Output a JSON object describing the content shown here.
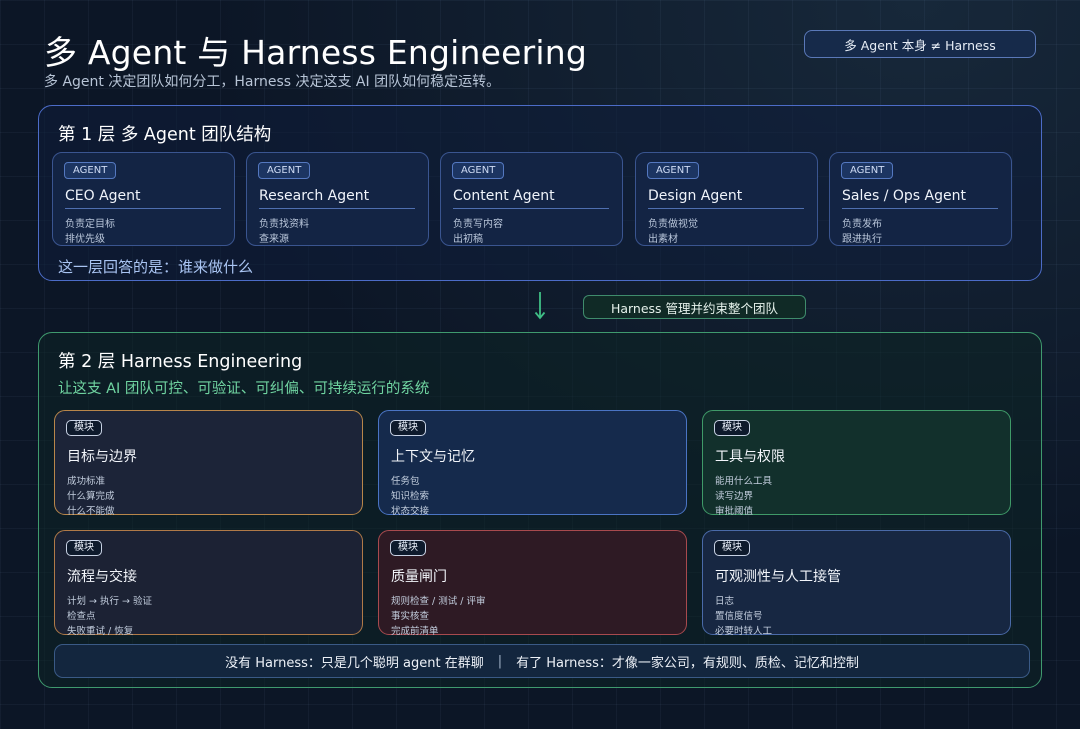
{
  "header": {
    "title": "多 Agent 与 Harness Engineering",
    "subtitle": "多 Agent 决定团队如何分工，Harness 决定这支 AI 团队如何稳定运转。",
    "badge": "多 Agent 本身 ≠ Harness"
  },
  "layer1": {
    "heading": "第 1 层  多 Agent 团队结构",
    "footer": "这一层回答的是：谁来做什么",
    "agents": [
      {
        "tag": "AGENT",
        "name": "CEO Agent",
        "desc": [
          "负责定目标",
          "排优先级"
        ]
      },
      {
        "tag": "AGENT",
        "name": "Research Agent",
        "desc": [
          "负责找资料",
          "查来源"
        ]
      },
      {
        "tag": "AGENT",
        "name": "Content Agent",
        "desc": [
          "负责写内容",
          "出初稿"
        ]
      },
      {
        "tag": "AGENT",
        "name": "Design Agent",
        "desc": [
          "负责做视觉",
          "出素材"
        ]
      },
      {
        "tag": "AGENT",
        "name": "Sales / Ops Agent",
        "desc": [
          "负责发布",
          "跟进执行"
        ]
      }
    ]
  },
  "connector": {
    "label": "Harness 管理并约束整个团队",
    "arrow_icon": "arrow-down-icon"
  },
  "layer2": {
    "heading": "第 2 层  Harness Engineering",
    "subtitle": "让这支 AI 团队可控、可验证、可纠偏、可持续运行的系统",
    "modules": [
      {
        "tag": "模块",
        "title": "目标与边界",
        "desc": [
          "成功标准",
          "什么算完成",
          "什么不能做"
        ],
        "accent": "#b8864a",
        "bg": "#1c2438"
      },
      {
        "tag": "模块",
        "title": "上下文与记忆",
        "desc": [
          "任务包",
          "知识检索",
          "状态交接"
        ],
        "accent": "#4a74c4",
        "bg": "#152a4c"
      },
      {
        "tag": "模块",
        "title": "工具与权限",
        "desc": [
          "能用什么工具",
          "读写边界",
          "审批阈值"
        ],
        "accent": "#3f9a68",
        "bg": "#12302c"
      },
      {
        "tag": "模块",
        "title": "流程与交接",
        "desc": [
          "计划 → 执行 → 验证",
          "检查点",
          "失败重试 / 恢复"
        ],
        "accent": "#b07a48",
        "bg": "#1c2234"
      },
      {
        "tag": "模块",
        "title": "质量闸门",
        "desc": [
          "规则检查 / 测试 / 评审",
          "事实核查",
          "完成前清单"
        ],
        "accent": "#a84a4e",
        "bg": "#2e1a24"
      },
      {
        "tag": "模块",
        "title": "可观测性与人工接管",
        "desc": [
          "日志",
          "置信度信号",
          "必要时转人工"
        ],
        "accent": "#4a6aa8",
        "bg": "#172742"
      }
    ],
    "bottom": {
      "left": "没有 Harness：只是几个聪明 agent 在群聊",
      "separator": "|",
      "right": "有了 Harness：才像一家公司，有规则、质检、记忆和控制"
    }
  },
  "colors": {
    "layer1_border": "#4c6cc8",
    "layer2_border": "#3f9a6e",
    "layer2_subtitle": "#6fd3a0",
    "layer1_footer": "#a9c4f2",
    "arrow": "#3fbf86"
  }
}
